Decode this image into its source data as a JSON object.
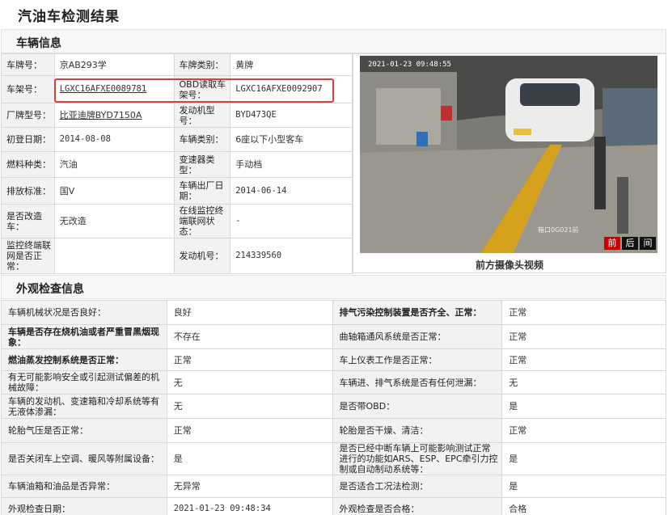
{
  "page": {
    "title": "汽油车检测结果"
  },
  "vehicle_section": {
    "title": "车辆信息"
  },
  "exterior_section": {
    "title": "外观检查信息"
  },
  "vehicle_rows": [
    {
      "l1": "车牌号：",
      "v1": "京AB293学",
      "l2": "车牌类别：",
      "v2": "黄牌"
    },
    {
      "l1": "车架号：",
      "v1": "LGXC16AFXE0089781",
      "l2": "OBD读取车架号：",
      "v2": "LGXC16AFXE0092907"
    },
    {
      "l1": "厂牌型号：",
      "v1": "比亚迪牌BYD7150A",
      "l2": "发动机型号：",
      "v2": "BYD473QE"
    },
    {
      "l1": "初登日期：",
      "v1": "2014-08-08",
      "l2": "车辆类别：",
      "v2": "6座以下小型客车"
    },
    {
      "l1": "燃料种类：",
      "v1": "汽油",
      "l2": "变速器类型：",
      "v2": "手动档"
    },
    {
      "l1": "排放标准：",
      "v1": "国V",
      "l2": "车辆出厂日期：",
      "v2": "2014-06-14"
    },
    {
      "l1": "是否改造车：",
      "v1": "无改造",
      "l2": "在线监控终端联网状态：",
      "v2": "-"
    },
    {
      "l1": "监控终端联网是否正常：",
      "v1": "",
      "l2": "发动机号：",
      "v2": "214339560"
    }
  ],
  "camera": {
    "caption": "前方摄像头视频",
    "timestamp": "2021-01-23 09:48:55",
    "overlay_label": "箱口0G021前",
    "buttons": [
      "前",
      "后",
      "间"
    ]
  },
  "exam_rows": [
    {
      "l1": "车辆机械状况是否良好：",
      "v1": "良好",
      "l2": "排气污染控制装置是否齐全、正常：",
      "v2": "正常"
    },
    {
      "l1": "车辆是否存在烧机油或者严重冒黑烟现象：",
      "v1": "不存在",
      "l2": "曲轴箱通风系统是否正常：",
      "v2": "正常"
    },
    {
      "l1": "燃油蒸发控制系统是否正常：",
      "v1": "正常",
      "l2": "车上仪表工作是否正常：",
      "v2": "正常"
    },
    {
      "l1": "有无可能影响安全或引起测试偏差的机械故障：",
      "v1": "无",
      "l2": "车辆进、排气系统是否有任何泄漏：",
      "v2": "无"
    },
    {
      "l1": "车辆的发动机、变速箱和冷却系统等有无液体渗漏：",
      "v1": "无",
      "l2": "是否带OBD：",
      "v2": "是"
    },
    {
      "l1": "轮胎气压是否正常：",
      "v1": "正常",
      "l2": "轮胎是否干燥、清洁：",
      "v2": "正常"
    },
    {
      "l1": "是否关闭车上空调、暖风等附属设备：",
      "v1": "是",
      "l2": "是否已经中断车辆上可能影响测试正常进行的功能如ARS、ESP、EPC牵引力控制或自动制动系统等：",
      "v2": "是"
    },
    {
      "l1": "车辆油箱和油品是否异常：",
      "v1": "无异常",
      "l2": "是否适合工况法检测：",
      "v2": "是"
    },
    {
      "l1": "外观检查日期：",
      "v1": "2021-01-23 09:48:34",
      "l2": "外观检查是否合格：",
      "v2": "合格"
    }
  ],
  "colors": {
    "highlight": "#e23b3b",
    "active_cam": "#cc0000"
  }
}
